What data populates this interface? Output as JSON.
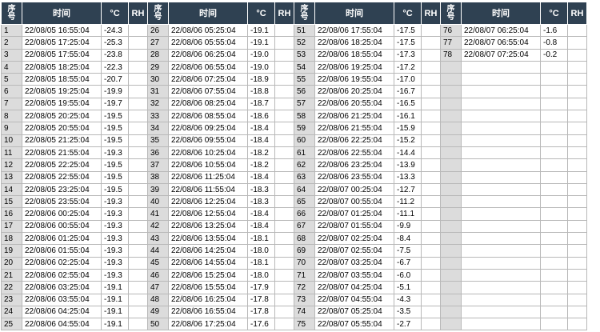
{
  "headers": {
    "seq": "序号",
    "time": "时间",
    "temp": "°C",
    "rh": "RH"
  },
  "rows": [
    [
      "1",
      "22/08/05 16:55:04",
      "-24.3",
      "26",
      "22/08/06 05:25:04",
      "-19.1",
      "51",
      "22/08/06 17:55:04",
      "-17.5",
      "76",
      "22/08/07 06:25:04",
      "-1.6"
    ],
    [
      "2",
      "22/08/05 17:25:04",
      "-25.3",
      "27",
      "22/08/06 05:55:04",
      "-19.1",
      "52",
      "22/08/06 18:25:04",
      "-17.5",
      "77",
      "22/08/07 06:55:04",
      "-0.8"
    ],
    [
      "3",
      "22/08/05 17:55:04",
      "-23.8",
      "28",
      "22/08/06 06:25:04",
      "-19.0",
      "53",
      "22/08/06 18:55:04",
      "-17.3",
      "78",
      "22/08/07 07:25:04",
      "-0.2"
    ],
    [
      "4",
      "22/08/05 18:25:04",
      "-22.3",
      "29",
      "22/08/06 06:55:04",
      "-19.0",
      "54",
      "22/08/06 19:25:04",
      "-17.2",
      "",
      "",
      ""
    ],
    [
      "5",
      "22/08/05 18:55:04",
      "-20.7",
      "30",
      "22/08/06 07:25:04",
      "-18.9",
      "55",
      "22/08/06 19:55:04",
      "-17.0",
      "",
      "",
      ""
    ],
    [
      "6",
      "22/08/05 19:25:04",
      "-19.9",
      "31",
      "22/08/06 07:55:04",
      "-18.8",
      "56",
      "22/08/06 20:25:04",
      "-16.7",
      "",
      "",
      ""
    ],
    [
      "7",
      "22/08/05 19:55:04",
      "-19.7",
      "32",
      "22/08/06 08:25:04",
      "-18.7",
      "57",
      "22/08/06 20:55:04",
      "-16.5",
      "",
      "",
      ""
    ],
    [
      "8",
      "22/08/05 20:25:04",
      "-19.5",
      "33",
      "22/08/06 08:55:04",
      "-18.6",
      "58",
      "22/08/06 21:25:04",
      "-16.1",
      "",
      "",
      ""
    ],
    [
      "9",
      "22/08/05 20:55:04",
      "-19.5",
      "34",
      "22/08/06 09:25:04",
      "-18.4",
      "59",
      "22/08/06 21:55:04",
      "-15.9",
      "",
      "",
      ""
    ],
    [
      "10",
      "22/08/05 21:25:04",
      "-19.5",
      "35",
      "22/08/06 09:55:04",
      "-18.4",
      "60",
      "22/08/06 22:25:04",
      "-15.2",
      "",
      "",
      ""
    ],
    [
      "11",
      "22/08/05 21:55:04",
      "-19.3",
      "36",
      "22/08/06 10:25:04",
      "-18.2",
      "61",
      "22/08/06 22:55:04",
      "-14.4",
      "",
      "",
      ""
    ],
    [
      "12",
      "22/08/05 22:25:04",
      "-19.5",
      "37",
      "22/08/06 10:55:04",
      "-18.2",
      "62",
      "22/08/06 23:25:04",
      "-13.9",
      "",
      "",
      ""
    ],
    [
      "13",
      "22/08/05 22:55:04",
      "-19.5",
      "38",
      "22/08/06 11:25:04",
      "-18.4",
      "63",
      "22/08/06 23:55:04",
      "-13.3",
      "",
      "",
      ""
    ],
    [
      "14",
      "22/08/05 23:25:04",
      "-19.5",
      "39",
      "22/08/06 11:55:04",
      "-18.3",
      "64",
      "22/08/07 00:25:04",
      "-12.7",
      "",
      "",
      ""
    ],
    [
      "15",
      "22/08/05 23:55:04",
      "-19.3",
      "40",
      "22/08/06 12:25:04",
      "-18.3",
      "65",
      "22/08/07 00:55:04",
      "-11.2",
      "",
      "",
      ""
    ],
    [
      "16",
      "22/08/06 00:25:04",
      "-19.3",
      "41",
      "22/08/06 12:55:04",
      "-18.4",
      "66",
      "22/08/07 01:25:04",
      "-11.1",
      "",
      "",
      ""
    ],
    [
      "17",
      "22/08/06 00:55:04",
      "-19.3",
      "42",
      "22/08/06 13:25:04",
      "-18.4",
      "67",
      "22/08/07 01:55:04",
      "-9.9",
      "",
      "",
      ""
    ],
    [
      "18",
      "22/08/06 01:25:04",
      "-19.3",
      "43",
      "22/08/06 13:55:04",
      "-18.1",
      "68",
      "22/08/07 02:25:04",
      "-8.4",
      "",
      "",
      ""
    ],
    [
      "19",
      "22/08/06 01:55:04",
      "-19.3",
      "44",
      "22/08/06 14:25:04",
      "-18.0",
      "69",
      "22/08/07 02:55:04",
      "-7.5",
      "",
      "",
      ""
    ],
    [
      "20",
      "22/08/06 02:25:04",
      "-19.3",
      "45",
      "22/08/06 14:55:04",
      "-18.1",
      "70",
      "22/08/07 03:25:04",
      "-6.7",
      "",
      "",
      ""
    ],
    [
      "21",
      "22/08/06 02:55:04",
      "-19.3",
      "46",
      "22/08/06 15:25:04",
      "-18.0",
      "71",
      "22/08/07 03:55:04",
      "-6.0",
      "",
      "",
      ""
    ],
    [
      "22",
      "22/08/06 03:25:04",
      "-19.1",
      "47",
      "22/08/06 15:55:04",
      "-17.9",
      "72",
      "22/08/07 04:25:04",
      "-5.1",
      "",
      "",
      ""
    ],
    [
      "23",
      "22/08/06 03:55:04",
      "-19.1",
      "48",
      "22/08/06 16:25:04",
      "-17.8",
      "73",
      "22/08/07 04:55:04",
      "-4.3",
      "",
      "",
      ""
    ],
    [
      "24",
      "22/08/06 04:25:04",
      "-19.1",
      "49",
      "22/08/06 16:55:04",
      "-17.8",
      "74",
      "22/08/07 05:25:04",
      "-3.5",
      "",
      "",
      ""
    ],
    [
      "25",
      "22/08/06 04:55:04",
      "-19.1",
      "50",
      "22/08/06 17:25:04",
      "-17.6",
      "75",
      "22/08/07 05:55:04",
      "-2.7",
      "",
      "",
      ""
    ]
  ]
}
